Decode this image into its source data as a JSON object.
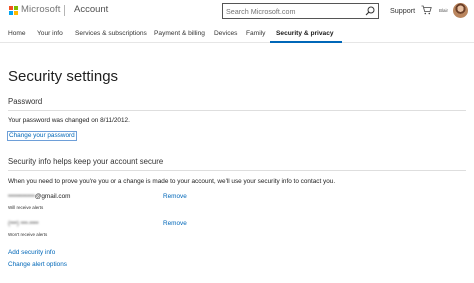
{
  "header": {
    "brand": "Microsoft",
    "section": "Account",
    "search_placeholder": "Search Microsoft.com",
    "support_label": "Support",
    "user_name": "Blair",
    "logo_colors": [
      "#f25022",
      "#7fba00",
      "#00a4ef",
      "#ffb900"
    ]
  },
  "nav": {
    "items": [
      {
        "label": "Home"
      },
      {
        "label": "Your info"
      },
      {
        "label": "Services & subscriptions"
      },
      {
        "label": "Payment & billing"
      },
      {
        "label": "Devices"
      },
      {
        "label": "Family"
      },
      {
        "label": "Security & privacy"
      }
    ],
    "active_index": 6,
    "accent_color": "#0067b8"
  },
  "page": {
    "title": "Security settings"
  },
  "password": {
    "heading": "Password",
    "changed_text": "Your password was changed on 8/11/2012.",
    "change_link": "Change your password"
  },
  "security_info": {
    "heading": "Security info helps keep your account secure",
    "description": "When you need to prove you're you or a change is made to your account, we'll use your security info to contact you.",
    "items": [
      {
        "value_hidden": "••••••••••••",
        "value_suffix": "@gmail.com",
        "note": "Will receive alerts",
        "remove_label": "Remove"
      },
      {
        "value_hidden": "(•••) •••-••••",
        "value_suffix": "",
        "note": "Won't receive alerts",
        "remove_label": "Remove"
      }
    ],
    "add_link": "Add security info",
    "alert_link": "Change alert options"
  }
}
